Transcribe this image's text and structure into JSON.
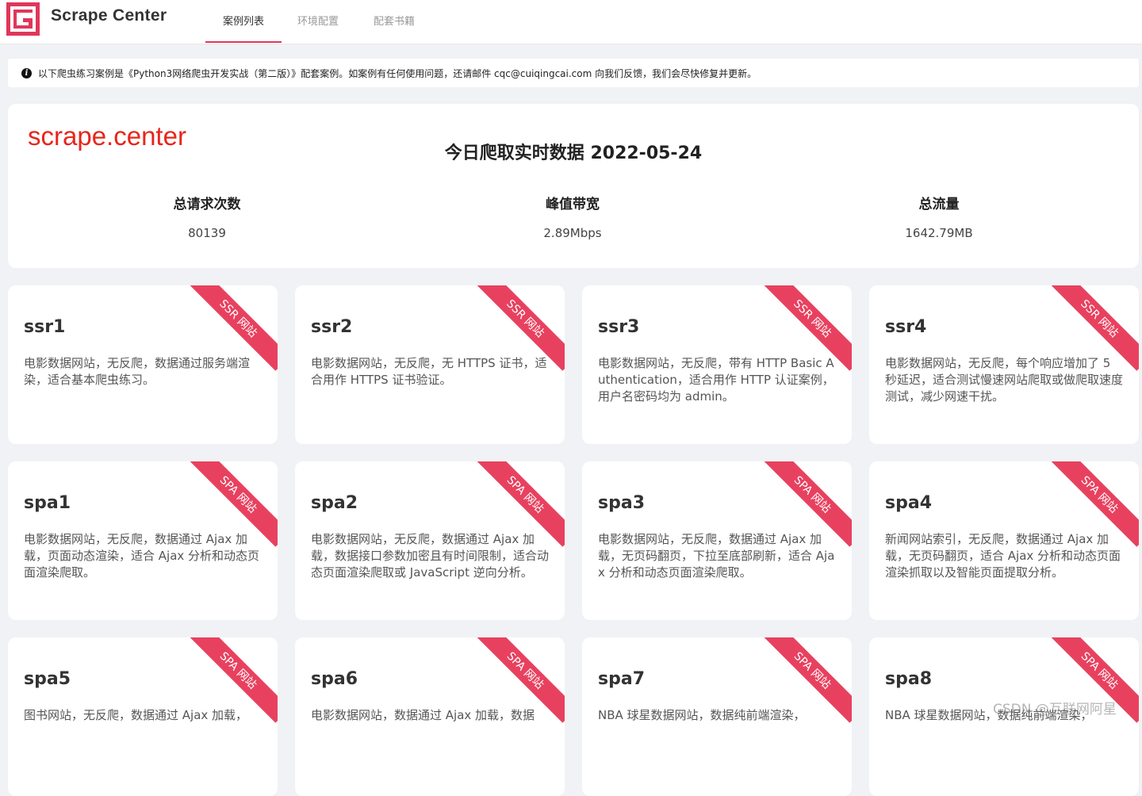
{
  "header": {
    "brand": "Scrape Center",
    "nav": [
      {
        "label": "案例列表",
        "active": true
      },
      {
        "label": "环境配置",
        "active": false
      },
      {
        "label": "配套书籍",
        "active": false
      }
    ]
  },
  "notice": {
    "icon": "info-icon",
    "text": "以下爬虫练习案例是《Python3网络爬虫开发实战（第二版）》配套案例。如案例有任何使用问题，还请邮件 cqc@cuiqingcai.com 向我们反馈，我们会尽快修复并更新。"
  },
  "stats": {
    "brand": "scrape.center",
    "title": "今日爬取实时数据 2022-05-24",
    "items": [
      {
        "label": "总请求次数",
        "value": "80139"
      },
      {
        "label": "峰值带宽",
        "value": "2.89Mbps"
      },
      {
        "label": "总流量",
        "value": "1642.79MB"
      }
    ]
  },
  "cards": [
    {
      "title": "ssr1",
      "ribbon": "SSR 网站",
      "desc": "电影数据网站，无反爬，数据通过服务端渲染，适合基本爬虫练习。"
    },
    {
      "title": "ssr2",
      "ribbon": "SSR 网站",
      "desc": "电影数据网站，无反爬，无 HTTPS 证书，适合用作 HTTPS 证书验证。"
    },
    {
      "title": "ssr3",
      "ribbon": "SSR 网站",
      "desc": "电影数据网站，无反爬，带有 HTTP Basic Authentication，适合用作 HTTP 认证案例，用户名密码均为 admin。"
    },
    {
      "title": "ssr4",
      "ribbon": "SSR 网站",
      "desc": "电影数据网站，无反爬，每个响应增加了 5 秒延迟，适合测试慢速网站爬取或做爬取速度测试，减少网速干扰。"
    },
    {
      "title": "spa1",
      "ribbon": "SPA 网站",
      "desc": "电影数据网站，无反爬，数据通过 Ajax 加载，页面动态渲染，适合 Ajax 分析和动态页面渲染爬取。"
    },
    {
      "title": "spa2",
      "ribbon": "SPA 网站",
      "desc": "电影数据网站，无反爬，数据通过 Ajax 加载，数据接口参数加密且有时间限制，适合动态页面渲染爬取或 JavaScript 逆向分析。"
    },
    {
      "title": "spa3",
      "ribbon": "SPA 网站",
      "desc": "电影数据网站，无反爬，数据通过 Ajax 加载，无页码翻页，下拉至底部刷新，适合 Ajax 分析和动态页面渲染爬取。"
    },
    {
      "title": "spa4",
      "ribbon": "SPA 网站",
      "desc": "新闻网站索引，无反爬，数据通过 Ajax 加载，无页码翻页，适合 Ajax 分析和动态页面渲染抓取以及智能页面提取分析。"
    },
    {
      "title": "spa5",
      "ribbon": "SPA 网站",
      "desc": "图书网站，无反爬，数据通过 Ajax 加载，"
    },
    {
      "title": "spa6",
      "ribbon": "SPA 网站",
      "desc": "电影数据网站，数据通过 Ajax 加载，数据"
    },
    {
      "title": "spa7",
      "ribbon": "SPA 网站",
      "desc": "NBA 球星数据网站，数据纯前端渲染，"
    },
    {
      "title": "spa8",
      "ribbon": "SPA 网站",
      "desc": "NBA 球星数据网站，数据纯前端渲染，"
    }
  ],
  "watermark": "CSDN @互联网阿星",
  "colors": {
    "accent": "#e0365a",
    "ribbon": "#e8415f",
    "stats_brand": "#e8251a"
  }
}
